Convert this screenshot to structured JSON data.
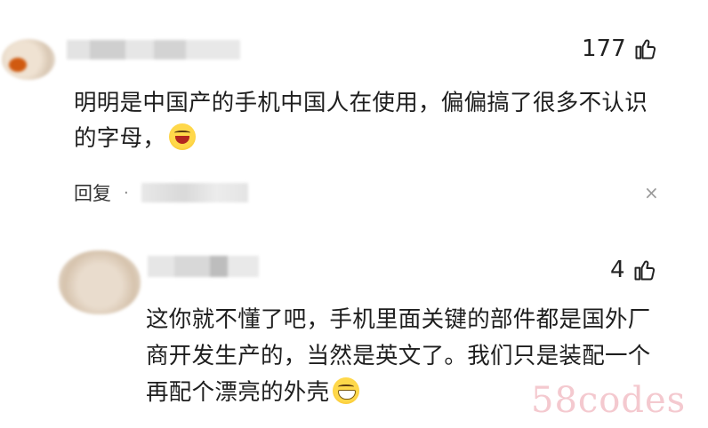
{
  "comments": [
    {
      "likes": "177",
      "text": "明明是中国产的手机中国人在使用，偏偏搞了很多不认识的字母，",
      "reply_label": "回复",
      "separator": "·",
      "close_icon": "×"
    },
    {
      "likes": "4",
      "text": "这你就不懂了吧，手机里面关键的部件都是国外厂商开发生产的，当然是英文了。我们只是装配一个再配个漂亮的外壳"
    }
  ],
  "watermark": "58codes",
  "icons": {
    "like": "thumbs-up-icon",
    "close": "close-icon",
    "emoji1": "laugh-cry-emoji-icon",
    "emoji2": "grin-emoji-icon"
  }
}
